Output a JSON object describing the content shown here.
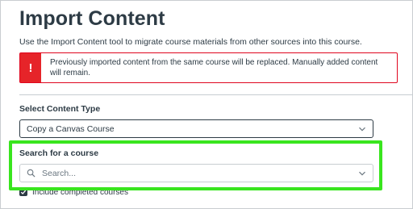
{
  "page": {
    "title": "Import Content",
    "intro": "Use the Import Content tool to migrate course materials from other sources into this course."
  },
  "alert": {
    "icon": "!",
    "icon_name": "warning-icon",
    "text": "Previously imported content from the same course will be replaced. Manually added content will remain.",
    "color": "#e62429"
  },
  "content_type": {
    "label": "Select Content Type",
    "selected": "Copy a Canvas Course"
  },
  "search": {
    "label": "Search for a course",
    "placeholder": "Search..."
  },
  "include_completed": {
    "label": "Include completed courses",
    "checked": true
  },
  "highlight_color": "#39e51e"
}
